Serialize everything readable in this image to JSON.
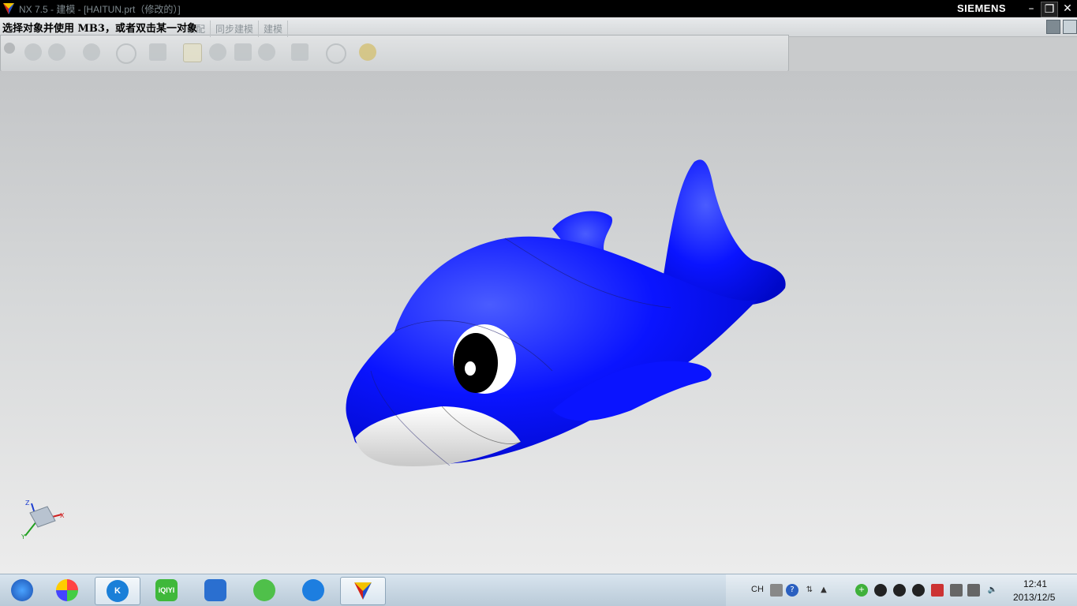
{
  "window": {
    "title": "NX 7.5 - 建模 - [HAITUN.prt（修改的）]",
    "brand": "SIEMENS"
  },
  "prompt": "选择对象并使用 MB3，或者双击某一对象",
  "ribbon": {
    "tabs": [
      {
        "label": "装配"
      },
      {
        "label": "同步建模"
      },
      {
        "label": "建模"
      }
    ]
  },
  "viewport": {
    "model_name": "dolphin",
    "triad": {
      "x": "X",
      "y": "Y",
      "z": "Z"
    }
  },
  "taskbar": {
    "apps": [
      {
        "name": "start-orb"
      },
      {
        "name": "photo-app-icon"
      },
      {
        "name": "kugou-icon",
        "label": "K"
      },
      {
        "name": "iqiyi-icon",
        "label": "iQIYI"
      },
      {
        "name": "video-editor-icon"
      },
      {
        "name": "sync-app-icon"
      },
      {
        "name": "media-player-icon"
      },
      {
        "name": "nx-app-icon"
      }
    ],
    "tray": {
      "lang": "CH",
      "time": "12:41",
      "date": "2013/12/5"
    }
  },
  "colors": {
    "dolphin_body": "#0a14ff",
    "dolphin_belly": "#ffffff",
    "titlebar": "#000000"
  }
}
